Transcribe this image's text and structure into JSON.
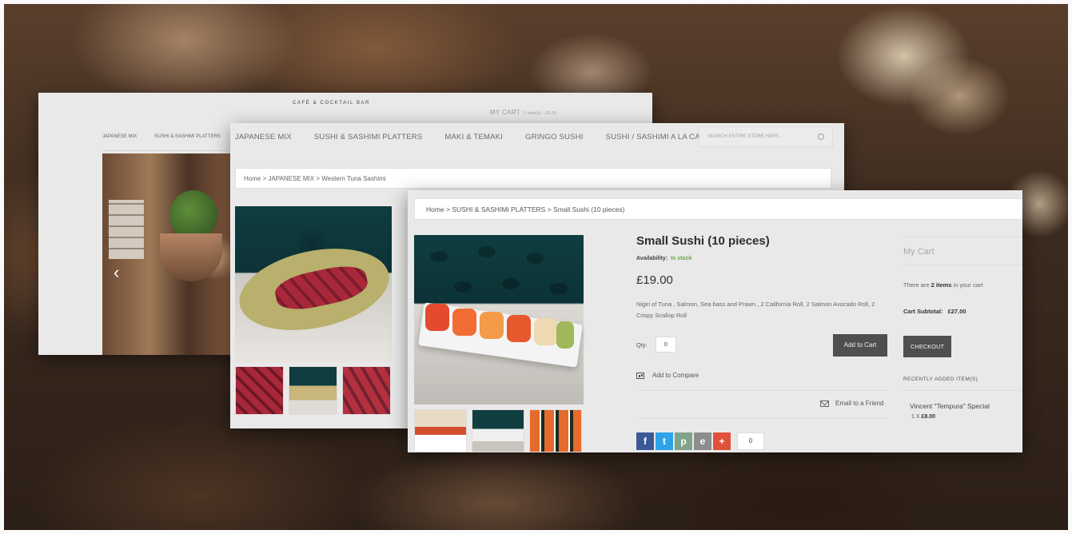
{
  "back": {
    "brand": "CAFÉ & COCKTAIL BAR",
    "mycart": "MY CART",
    "mycart_sub": "1 item(s) - £0.00",
    "nav": [
      "JAPANESE MIX",
      "SUSHI & SASHIMI PLATTERS"
    ],
    "slider_prev": "‹"
  },
  "mid": {
    "nav": [
      "JAPANESE MIX",
      "SUSHI & SASHIMI PLATTERS",
      "MAKI & TEMAKI",
      "GRINGO SUSHI",
      "SUSHI / SASHIMI A LA CARTE"
    ],
    "search_placeholder": "SEARCH ENTIRE STORE HERE...",
    "breadcrumb": "Home  >  JAPANESE MIX  >  Western Tuna Sashimi"
  },
  "front": {
    "breadcrumb": "Home  >  SUSHI & SASHIMI PLATTERS  >  Small Sushi (10 pieces)",
    "title": "Small Sushi (10 pieces)",
    "availability_label": "Availability:",
    "availability_value": "In stock",
    "price": "£19.00",
    "description": "Nigiri of Tuna , Salmon, Sea bass and Prawn , 2 California Roll, 2 Salmon Avocado Roll, 2 Crispy Scallop Roll",
    "qty_label": "Qty:",
    "qty_value": "0",
    "add_to_cart": "Add to Cart",
    "add_to_compare": "Add to Compare",
    "email_friend": "Email to a Friend",
    "share_count": "0",
    "sidebar": {
      "cart_title": "My Cart",
      "cart_info_pre": "There are ",
      "cart_info_count": "2 items",
      "cart_info_post": " in your cart",
      "subtotal_label": "Cart Subtotal:",
      "subtotal_value": "£27.00",
      "checkout": "CHECKOUT",
      "recent_title": "RECENTLY ADDED ITEM(S)",
      "recent_item": "Vincent \"Tempura\" Special",
      "recent_qty": "1 X",
      "recent_price": "£8.00"
    }
  },
  "icons": {
    "facebook": "f",
    "twitter": "t",
    "print": "p",
    "email": "e",
    "plus": "+"
  }
}
